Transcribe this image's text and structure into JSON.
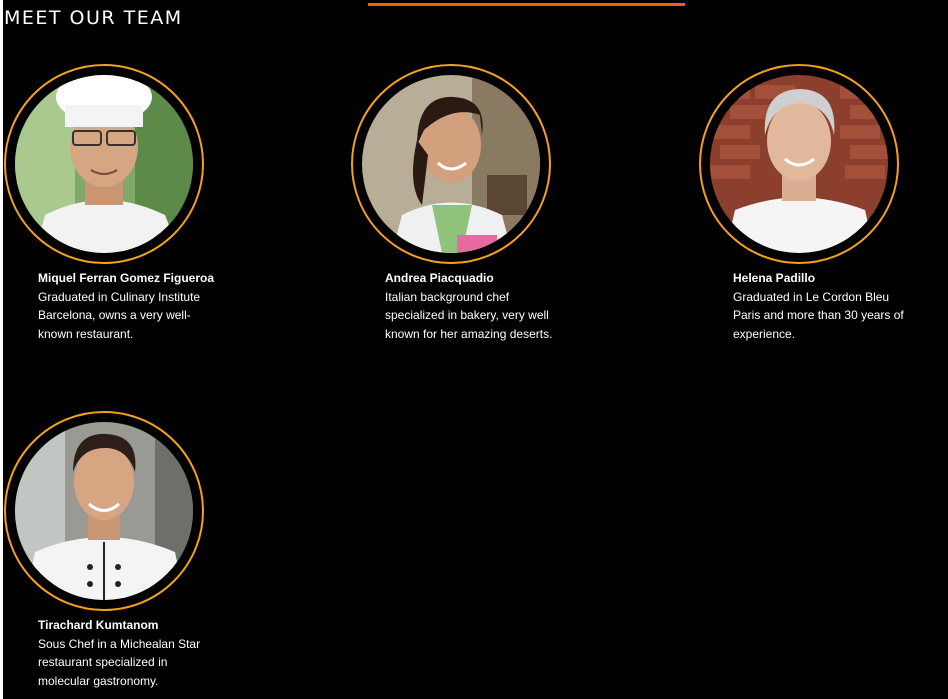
{
  "section": {
    "title": "MEET OUR TEAM"
  },
  "colors": {
    "background": "#000000",
    "ring": "#f5a11b",
    "accent_line": "#e8621a",
    "text": "#ffffff"
  },
  "team": [
    {
      "name": "Miquel Ferran Gomez Figueroa",
      "bio": "Graduated in Culinary Institute Barcelona, owns a very well-known restaurant.",
      "photo": "chef-with-toque-and-glasses"
    },
    {
      "name": "Andrea Piacquadio",
      "bio": "Italian background chef specialized in bakery, very well known for her amazing deserts.",
      "photo": "smiling-woman-in-apron"
    },
    {
      "name": "Helena Padillo",
      "bio": "Graduated in Le Cordon Bleu Paris and more than 30 years of experience.",
      "photo": "gray-haired-woman-brick-wall"
    },
    {
      "name": "Tirachard Kumtanom",
      "bio": "Sous Chef in a Michealan Star restaurant specialized in molecular gastronomy.",
      "photo": "smiling-man-chef-jacket"
    }
  ]
}
